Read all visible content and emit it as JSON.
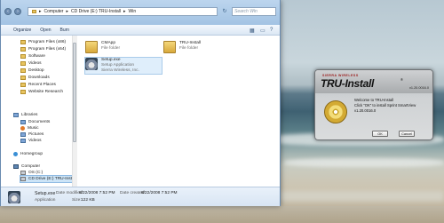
{
  "window": {
    "address_segments": [
      "Computer",
      "CD Drive (E:) TRU-Install",
      "Win"
    ],
    "search_placeholder": "Search Win",
    "toolbar": {
      "organize": "Organize",
      "open": "Open",
      "burn": "Burn"
    }
  },
  "nav_pane": {
    "favorites": [
      {
        "label": "Program Files (x86)",
        "icon": "folder-icon"
      },
      {
        "label": "Program Files (x64)",
        "icon": "folder-icon"
      },
      {
        "label": "Software",
        "icon": "folder-icon"
      },
      {
        "label": "Videos",
        "icon": "folder-icon"
      },
      {
        "label": "Desktop",
        "icon": "folder-icon"
      },
      {
        "label": "Downloads",
        "icon": "folder-icon"
      },
      {
        "label": "Recent Places",
        "icon": "folder-icon"
      },
      {
        "label": "Website Research",
        "icon": "folder-icon"
      }
    ],
    "libraries_header": "Libraries",
    "libraries": [
      {
        "label": "Documents",
        "icon": "library-icon"
      },
      {
        "label": "Music",
        "icon": "music-icon"
      },
      {
        "label": "Pictures",
        "icon": "library-icon"
      },
      {
        "label": "Videos",
        "icon": "library-icon"
      }
    ],
    "homegroup": "Homegroup",
    "computer": "Computer",
    "drives": [
      {
        "label": "OS (C:)",
        "icon": "drive-icon"
      },
      {
        "label": "CD Drive (E:) TRU-Install",
        "icon": "drive-icon",
        "selected": true
      }
    ]
  },
  "files": [
    {
      "name": "CMApp",
      "type": "File folder",
      "extra": ""
    },
    {
      "name": "TRU-Install",
      "type": "File folder",
      "extra": ""
    },
    {
      "name": "Setup.exe",
      "type": "Setup Application",
      "extra": "Sierra Wireless, Inc."
    }
  ],
  "details": {
    "name": "Setup.exe",
    "kind": "Application",
    "modified_label": "Date modified:",
    "modified_value": "8/22/2008 7:52 PM",
    "created_label": "Date created:",
    "created_value": "8/22/2008 7:52 PM",
    "size_label": "Size:",
    "size_value": "122 KB"
  },
  "dialog": {
    "brand": "SIERRA WIRELESS",
    "product": "TRU-Install",
    "registered": "®",
    "version_small": "v1.20.0016.0",
    "message_line1": "Welcome to  TRU-Install",
    "message_line2": "Click \"OK\" to install Sprint SmartView",
    "message_line3": "v1.20.0016.0",
    "ok_label": "OK",
    "cancel_label": "Cancel"
  }
}
